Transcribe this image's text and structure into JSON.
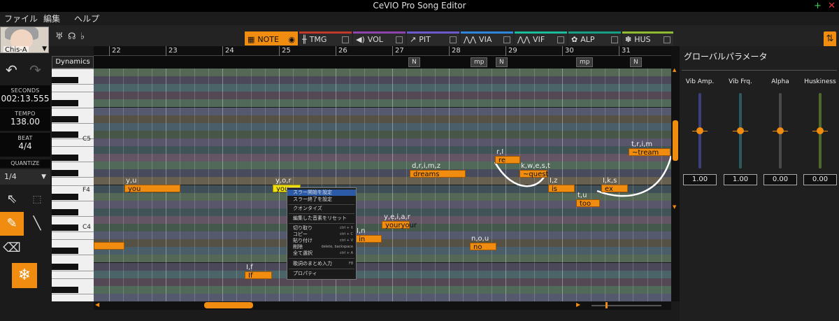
{
  "window": {
    "title": "CeVIO Pro Song Editor"
  },
  "menu": [
    "ファイル",
    "編集",
    "ヘルプ"
  ],
  "singer": {
    "name": "Chis-A"
  },
  "tabs": [
    {
      "label": "NOTE",
      "color": "#f08c10",
      "active": true
    },
    {
      "label": "TMG",
      "color": "#c0392b"
    },
    {
      "label": "VOL",
      "color": "#8e44ad"
    },
    {
      "label": "PIT",
      "color": "#6a5acd"
    },
    {
      "label": "VIA",
      "color": "#2e86de"
    },
    {
      "label": "VIF",
      "color": "#1abc9c"
    },
    {
      "label": "ALP",
      "color": "#16a085"
    },
    {
      "label": "HUS",
      "color": "#8fbc2f"
    }
  ],
  "info": {
    "seconds_label": "SECONDS",
    "seconds": "002:13.555",
    "tempo_label": "TEMPO",
    "tempo": "138.00",
    "beat_label": "BEAT",
    "beat": "4/4",
    "quantize_label": "QUANTIZE",
    "quantize": "1/4"
  },
  "dynamics_label": "Dynamics",
  "bars": [
    "22",
    "23",
    "24",
    "25",
    "26",
    "27",
    "28",
    "29",
    "30",
    "31"
  ],
  "dynamics": [
    "N",
    "mp",
    "N",
    "mp",
    "N"
  ],
  "octaves": [
    "C5",
    "F4",
    "C4"
  ],
  "notes": [
    {
      "lyric": "you",
      "phon": "y,u"
    },
    {
      "lyric": "you",
      "phon": "y,o,r"
    },
    {
      "lyric": "If",
      "phon": "I,f"
    },
    {
      "lyric": "in",
      "phon": "I,n"
    },
    {
      "lyric": "youryour",
      "phon": "y,e,i,a,r"
    },
    {
      "lyric": "dreams",
      "phon": "d,r,i,m,z"
    },
    {
      "lyric": "no",
      "phon": "n,o,u"
    },
    {
      "lyric": "re",
      "phon": "r,I"
    },
    {
      "lyric": "~quest",
      "phon": "k,w,e,s,t"
    },
    {
      "lyric": "is",
      "phon": "I,z"
    },
    {
      "lyric": "too",
      "phon": "t,u"
    },
    {
      "lyric": "ex",
      "phon": "I,k,s"
    },
    {
      "lyric": "~tream",
      "phon": "t,r,i,m"
    },
    {
      "lyric": "",
      "phon": ""
    }
  ],
  "context_menu": [
    {
      "label": "スラー開始を設定",
      "shortcut": ""
    },
    {
      "label": "スラー終了を設定",
      "shortcut": ""
    },
    {
      "label": "クオンタイズ",
      "shortcut": ""
    },
    {
      "label": "編集した音素をリセット",
      "shortcut": ""
    },
    {
      "label": "切り取り",
      "shortcut": "ctrl + X"
    },
    {
      "label": "コピー",
      "shortcut": "ctrl + C"
    },
    {
      "label": "貼り付け",
      "shortcut": "ctrl + V"
    },
    {
      "label": "削除",
      "shortcut": "delete, backspace"
    },
    {
      "label": "全て選択",
      "shortcut": "ctrl + A"
    },
    {
      "label": "歌詞のまとめ入力",
      "shortcut": "F8"
    },
    {
      "label": "プロパティ",
      "shortcut": ""
    }
  ],
  "global_params": {
    "title": "グローバルパラメータ",
    "sliders": [
      {
        "label": "Vib Amp.",
        "value": "1.00",
        "level": 0.5,
        "track_color": "#3b3f7a"
      },
      {
        "label": "Vib Frq.",
        "value": "1.00",
        "level": 0.5,
        "track_color": "#2b5a5e"
      },
      {
        "label": "Alpha",
        "value": "0.00",
        "level": 0.5,
        "track_color": "#4a4a4a"
      },
      {
        "label": "Huskiness",
        "value": "0.00",
        "level": 0.5,
        "track_color": "#4d6a2a"
      }
    ]
  }
}
